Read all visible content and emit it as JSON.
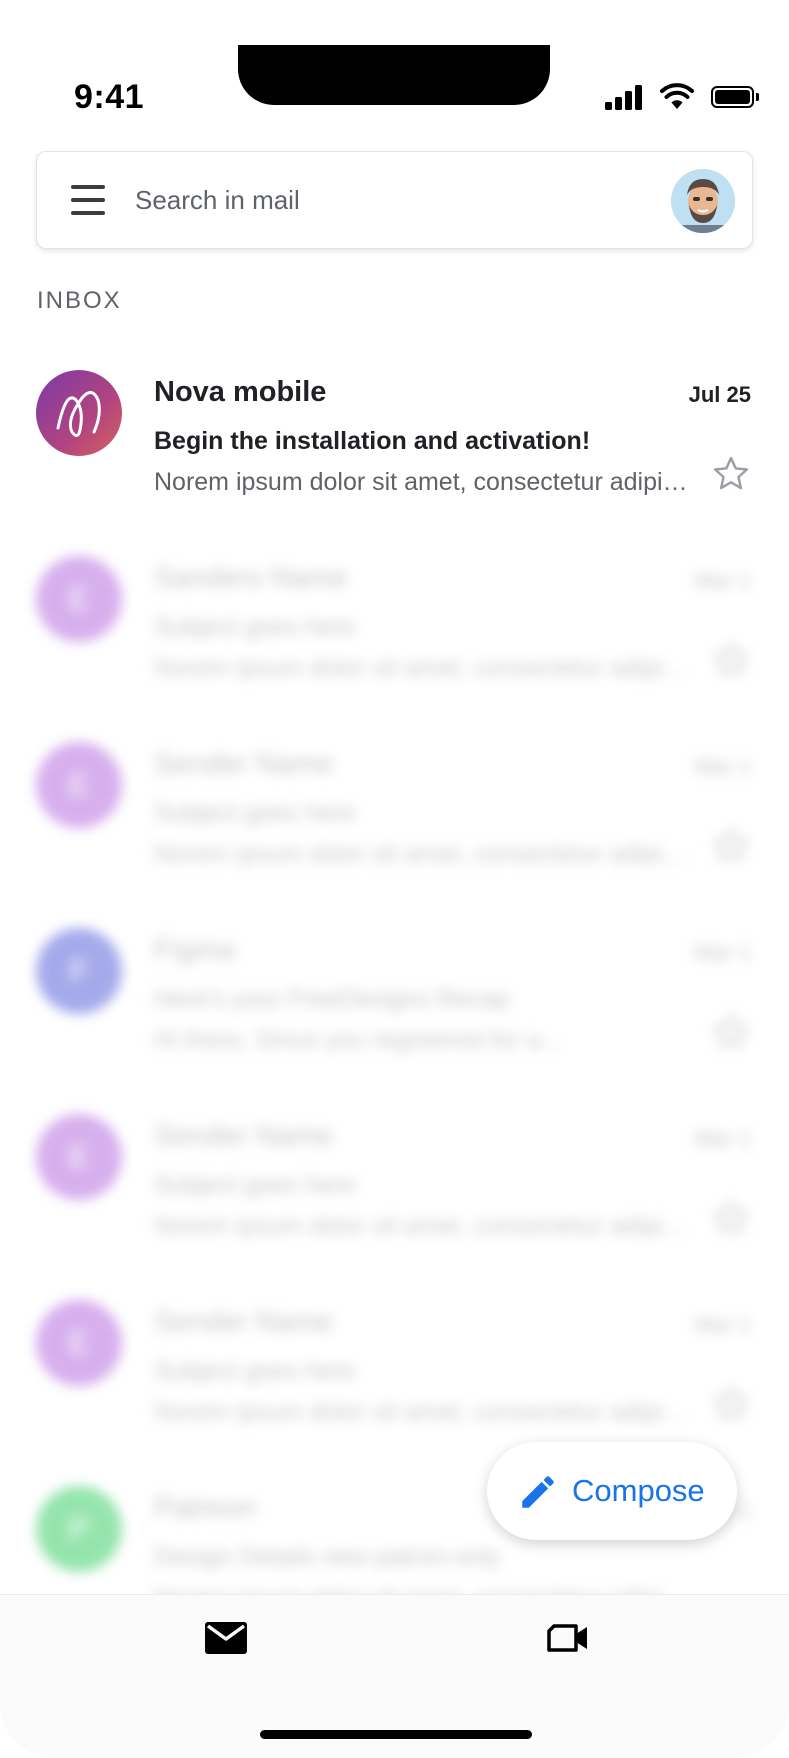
{
  "status_bar": {
    "time": "9:41"
  },
  "search": {
    "placeholder": "Search in mail"
  },
  "inbox": {
    "label": "INBOX",
    "emails": [
      {
        "sender": "Nova mobile",
        "date": "Jul 25",
        "subject": "Begin the installation and activation!",
        "preview": "Norem ipsum dolor sit amet, consectetur adipiscing elit.",
        "avatar_color": "#9c3d8c",
        "starred": false,
        "blurred": false
      },
      {
        "sender": "Sanders Name",
        "date": "Mar 1",
        "subject": "Subject goes here",
        "preview": "Norem ipsum dolor sit amet, consectetur adipiscing.",
        "avatar_letter": "E",
        "avatar_color": "#b66ee0",
        "blurred": true
      },
      {
        "sender": "Sender Name",
        "date": "Mar 1",
        "subject": "Subject goes here",
        "preview": "Norem ipsum dolor sit amet, consectetur adipiscing.",
        "avatar_letter": "E",
        "avatar_color": "#b66ee0",
        "blurred": true
      },
      {
        "sender": "Figma",
        "date": "Mar 1",
        "subject": "Here's your FreeDesigns Recap",
        "preview": "Hi there, Since you registered for a...",
        "avatar_letter": "F",
        "avatar_color": "#5b64db",
        "blurred": true
      },
      {
        "sender": "Sender Name",
        "date": "Mar 1",
        "subject": "Subject goes here",
        "preview": "Norem ipsum dolor sit amet, consectetur adipiscing.",
        "avatar_letter": "E",
        "avatar_color": "#b66ee0",
        "blurred": true
      },
      {
        "sender": "Sender Name",
        "date": "Mar 1",
        "subject": "Subject goes here",
        "preview": "Norem ipsum dolor sit amet, consectetur adipiscing.",
        "avatar_letter": "E",
        "avatar_color": "#b66ee0",
        "blurred": true
      },
      {
        "sender": "Patreon",
        "date": "Mar 1",
        "subject": "Design Details new patron-only",
        "preview": "Norem ipsum dolor sit amet, consectetur adipiscing.",
        "avatar_letter": "P",
        "avatar_color": "#3fcf6b",
        "blurred": true
      }
    ]
  },
  "compose": {
    "label": "Compose"
  },
  "colors": {
    "accent": "#1a73e8",
    "text_primary": "#202124",
    "text_secondary": "#5f6368"
  },
  "nav": {
    "tabs": [
      {
        "icon": "mail-icon"
      },
      {
        "icon": "video-icon"
      }
    ]
  }
}
